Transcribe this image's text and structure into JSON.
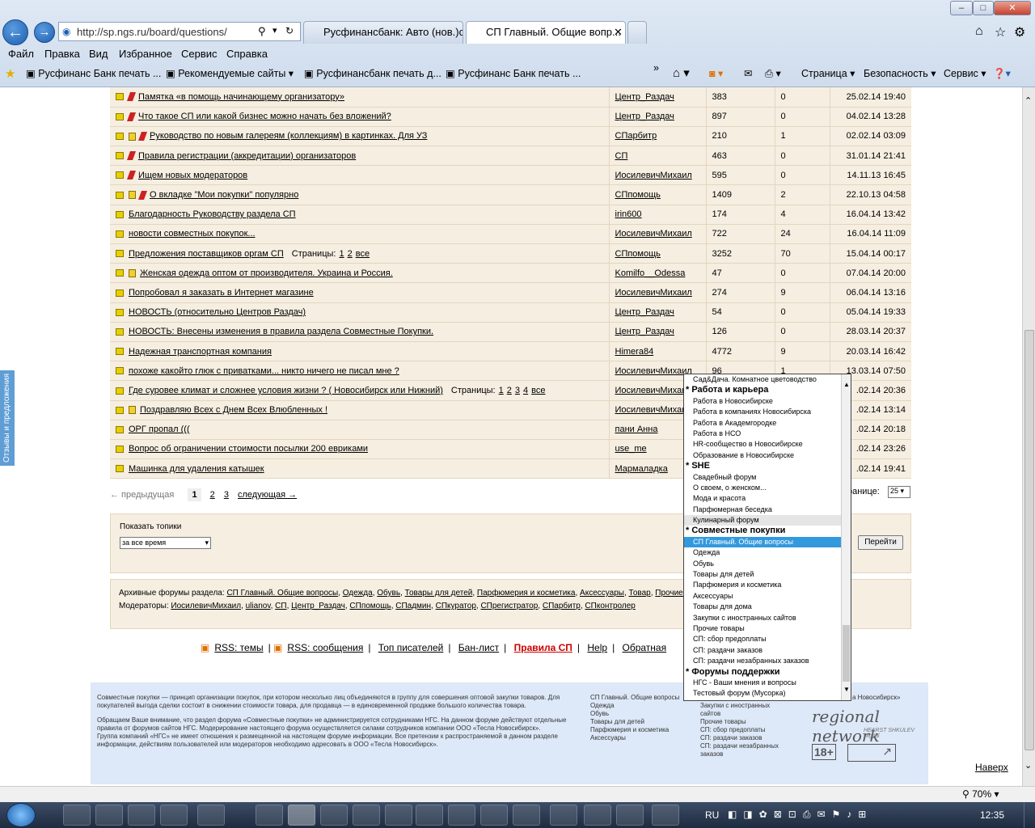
{
  "browser": {
    "url": "http://sp.ngs.ru/board/questions/",
    "tabs": [
      {
        "label": "Русфинансбанк: Авто (нов.)с...",
        "active": false
      },
      {
        "label": "СП Главный. Общие вопр...",
        "active": true
      }
    ],
    "menu": [
      "Файл",
      "Правка",
      "Вид",
      "Избранное",
      "Сервис",
      "Справка"
    ],
    "favorites": [
      "Русфинанс Банк печать ...",
      "Рекомендуемые сайты",
      "Русфинансбанк печать д...",
      "Русфинанс Банк печать ..."
    ],
    "commands": [
      "Страница",
      "Безопасность",
      "Сервис"
    ],
    "zoom": "70%"
  },
  "feedback_tab": "Отзывы и предложения",
  "topics": [
    {
      "title": "Памятка «в помощь начинающему организатору»",
      "icons": [
        "flag",
        "pin"
      ],
      "author": "Центр_Раздач",
      "views": "383",
      "replies": "0",
      "date": "25.02.14 19:40"
    },
    {
      "title": "Что такое СП или какой бизнес можно начать без вложений?",
      "icons": [
        "flag",
        "pin"
      ],
      "author": "Центр_Раздач",
      "views": "897",
      "replies": "0",
      "date": "04.02.14 13:28"
    },
    {
      "title": "Руководство по новым галереям (коллекциям) в картинках. Для УЗ",
      "icons": [
        "flag",
        "lock",
        "pin"
      ],
      "author": "СПарбитр",
      "views": "210",
      "replies": "1",
      "date": "02.02.14 03:09"
    },
    {
      "title": "Правила регистрации (аккредитации) организаторов",
      "icons": [
        "flag",
        "pin"
      ],
      "author": "СП",
      "views": "463",
      "replies": "0",
      "date": "31.01.14 21:41"
    },
    {
      "title": "Ищем новых модераторов",
      "icons": [
        "flag",
        "pin"
      ],
      "author": "ИосилевичМихаил",
      "views": "595",
      "replies": "0",
      "date": "14.11.13 16:45"
    },
    {
      "title": "О вкладке \"Мои покупки\" популярно",
      "icons": [
        "flag",
        "lock",
        "pin"
      ],
      "author": "СПпомощь",
      "views": "1409",
      "replies": "2",
      "date": "22.10.13 04:58"
    },
    {
      "title": "Благодарность Руководству раздела СП",
      "icons": [
        "flag"
      ],
      "author": "irin600",
      "views": "174",
      "replies": "4",
      "date": "16.04.14 13:42"
    },
    {
      "title": "новости совместных покупок...",
      "icons": [
        "flag"
      ],
      "author": "ИосилевичМихаил",
      "views": "722",
      "replies": "24",
      "date": "16.04.14 11:09"
    },
    {
      "title": "Предложения поставщиков оргам СП",
      "icons": [
        "flag"
      ],
      "pages": [
        "1",
        "2",
        "все"
      ],
      "author": "СПпомощь",
      "views": "3252",
      "replies": "70",
      "date": "15.04.14 00:17"
    },
    {
      "title": "Женская одежда оптом от производителя. Украина и Россия.",
      "icons": [
        "flag",
        "lock"
      ],
      "author": "Komilfo__Odessa",
      "views": "47",
      "replies": "0",
      "date": "07.04.14 20:00"
    },
    {
      "title": "Попробовал я заказать в Интернет магазине",
      "icons": [
        "flag"
      ],
      "author": "ИосилевичМихаил",
      "views": "274",
      "replies": "9",
      "date": "06.04.14 13:16"
    },
    {
      "title": "НОВОСТЬ (относительно Центров Раздач)",
      "icons": [
        "flag"
      ],
      "author": "Центр_Раздач",
      "views": "54",
      "replies": "0",
      "date": "05.04.14 19:33"
    },
    {
      "title": "НОВОСТЬ: Внесены изменения в правила раздела Совместные Покупки.",
      "icons": [
        "flag"
      ],
      "author": "Центр_Раздач",
      "views": "126",
      "replies": "0",
      "date": "28.03.14 20:37"
    },
    {
      "title": "Надежная транспортная компания",
      "icons": [
        "flag"
      ],
      "author": "Himera84",
      "views": "4772",
      "replies": "9",
      "date": "20.03.14 16:42"
    },
    {
      "title": "похоже какойто глюк с приватками... никто ничего не писал мне ?",
      "icons": [
        "flag"
      ],
      "author": "ИосилевичМихаил",
      "views": "96",
      "replies": "1",
      "date": "13.03.14 07:50"
    },
    {
      "title": "Где суровее климат и сложнее условия жизни ? ( Новосибирск или Нижний)",
      "icons": [
        "flag"
      ],
      "pages": [
        "1",
        "2",
        "3",
        "4",
        "все"
      ],
      "author": "ИосилевичМихаил",
      "views": "",
      "replies": "",
      "date": ".02.14 20:36"
    },
    {
      "title": "Поздравляю Всех с Днем Всех Влюбленных !",
      "icons": [
        "flag",
        "lock"
      ],
      "author": "ИосилевичМихаил",
      "views": "",
      "replies": "",
      "date": ".02.14 13:14"
    },
    {
      "title": "ОРГ пропал (((",
      "icons": [
        "flag"
      ],
      "author": "пани Анна",
      "views": "",
      "replies": "",
      "date": ".02.14 20:18"
    },
    {
      "title": "Вопрос об ограничении стоимости посылки 200 евриками",
      "icons": [
        "flag"
      ],
      "author": "use_me",
      "views": "",
      "replies": "",
      "date": ".02.14 23:26"
    },
    {
      "title": "Машинка для удаления катышек",
      "icons": [
        "flag"
      ],
      "author": "Мармаладка",
      "views": "",
      "replies": "",
      "date": ".02.14 19:41"
    }
  ],
  "pager": {
    "prev": "← предыдущая",
    "current": "1",
    "pages": [
      "2",
      "3"
    ],
    "next": "следующая →",
    "per_page_label": "ранице:",
    "per_page_value": "25"
  },
  "show_topics": {
    "label": "Показать топики",
    "value": "за все время",
    "go": "Перейти"
  },
  "archive": {
    "label": "Архивные форумы раздела:",
    "forums": [
      "СП Главный. Общие вопросы",
      "Одежда",
      "Обувь",
      "Товары для детей",
      "Парфюмерия и косметика",
      "Аксессуары",
      "Товар",
      "Прочие товары"
    ],
    "moderators_label": "Модераторы:",
    "moderators": [
      "ИосилевичМихаил",
      "ulianov",
      "СП",
      "Центр_Раздач",
      "СПпомощь",
      "СПадмин",
      "СПкуратор",
      "СПрегистратор",
      "СПарбитр",
      "СПконтролер"
    ]
  },
  "bottom_links": [
    "RSS: темы",
    "RSS: сообщения",
    "Топ писателей",
    "Бан-лист",
    "Правила СП",
    "Help",
    "Обратная"
  ],
  "footer": {
    "p1": "Совместные покупки — принцип организации покупок, при котором несколько лиц объединяются в группу для совершения оптовой закупки товаров. Для покупателей выгода сделки состоит в снижении стоимости товара, для продавца — в единовременной продаже большого количества товара.",
    "p2": "Обращаем Ваше внимание, что раздел форума «Совместные покупки» не администрируется сотрудниками НГС. На данном форуме действуют отдельные правила от форумов сайтов НГС. Модерирование настоящего форума осуществляется силами сотрудников компании ООО «Тесла Новосибирск».",
    "p3": "Группа компаний «НГС» не имеет отношения к размещенной на настоящем форуме информации. Все претензии к распространяемой в данном разделе информации, действиям пользователей или модераторов необходимо адресовать в ООО «Тесла Новосибирск».",
    "col1": [
      "СП Главный. Общие вопросы",
      "Одежда",
      "Обувь",
      "Товары для детей",
      "Парфюмерия и косметика",
      "Аксессуары"
    ],
    "col2": [
      "Закупки с иностранных сайтов",
      "Прочие товары",
      "СП: сбор предоплаты",
      "СП: раздачи заказов",
      "СП: раздачи незабранных заказов"
    ],
    "col3": "а Новосибирск»",
    "brand": "regional network",
    "brand_sub": "HEARST SHKULEV Digital",
    "age": "18+",
    "top_link": "Наверх"
  },
  "dropdown": [
    {
      "type": "opt",
      "label": "Сад&Дача. Комнатное цветоводство"
    },
    {
      "type": "grp",
      "label": "* Работа и карьера"
    },
    {
      "type": "opt",
      "label": "Работа в Новосибирске"
    },
    {
      "type": "opt",
      "label": "Работа в компаниях Новосибирска"
    },
    {
      "type": "opt",
      "label": "Работа в Академгородке"
    },
    {
      "type": "opt",
      "label": "Работа в НСО"
    },
    {
      "type": "opt",
      "label": "HR-сообщество в Новосибирске"
    },
    {
      "type": "opt",
      "label": "Образование в Новосибирске"
    },
    {
      "type": "grp",
      "label": "* SHE"
    },
    {
      "type": "opt",
      "label": "Свадебный форум"
    },
    {
      "type": "opt",
      "label": "О своем, о женском..."
    },
    {
      "type": "opt",
      "label": "Мода и красота"
    },
    {
      "type": "opt",
      "label": "Парфюмерная беседка"
    },
    {
      "type": "opt",
      "label": "Кулинарный форум",
      "hover": true
    },
    {
      "type": "grp",
      "label": "* Совместные покупки"
    },
    {
      "type": "opt",
      "label": "СП Главный. Общие вопросы",
      "selected": true
    },
    {
      "type": "opt",
      "label": "Одежда"
    },
    {
      "type": "opt",
      "label": "Обувь"
    },
    {
      "type": "opt",
      "label": "Товары для детей"
    },
    {
      "type": "opt",
      "label": "Парфюмерия и косметика"
    },
    {
      "type": "opt",
      "label": "Аксессуары"
    },
    {
      "type": "opt",
      "label": "Товары для дома"
    },
    {
      "type": "opt",
      "label": "Закупки с иностранных сайтов"
    },
    {
      "type": "opt",
      "label": "Прочие товары"
    },
    {
      "type": "opt",
      "label": "СП: сбор предоплаты"
    },
    {
      "type": "opt",
      "label": "СП: раздачи заказов"
    },
    {
      "type": "opt",
      "label": "СП: раздачи незабранных заказов"
    },
    {
      "type": "grp",
      "label": "* Форумы поддержки"
    },
    {
      "type": "opt",
      "label": "НГС - Ваши мнения и вопросы"
    },
    {
      "type": "opt",
      "label": "Тестовый форум (Мусорка)"
    }
  ],
  "taskbar": {
    "lang": "RU",
    "time": "12:35"
  }
}
